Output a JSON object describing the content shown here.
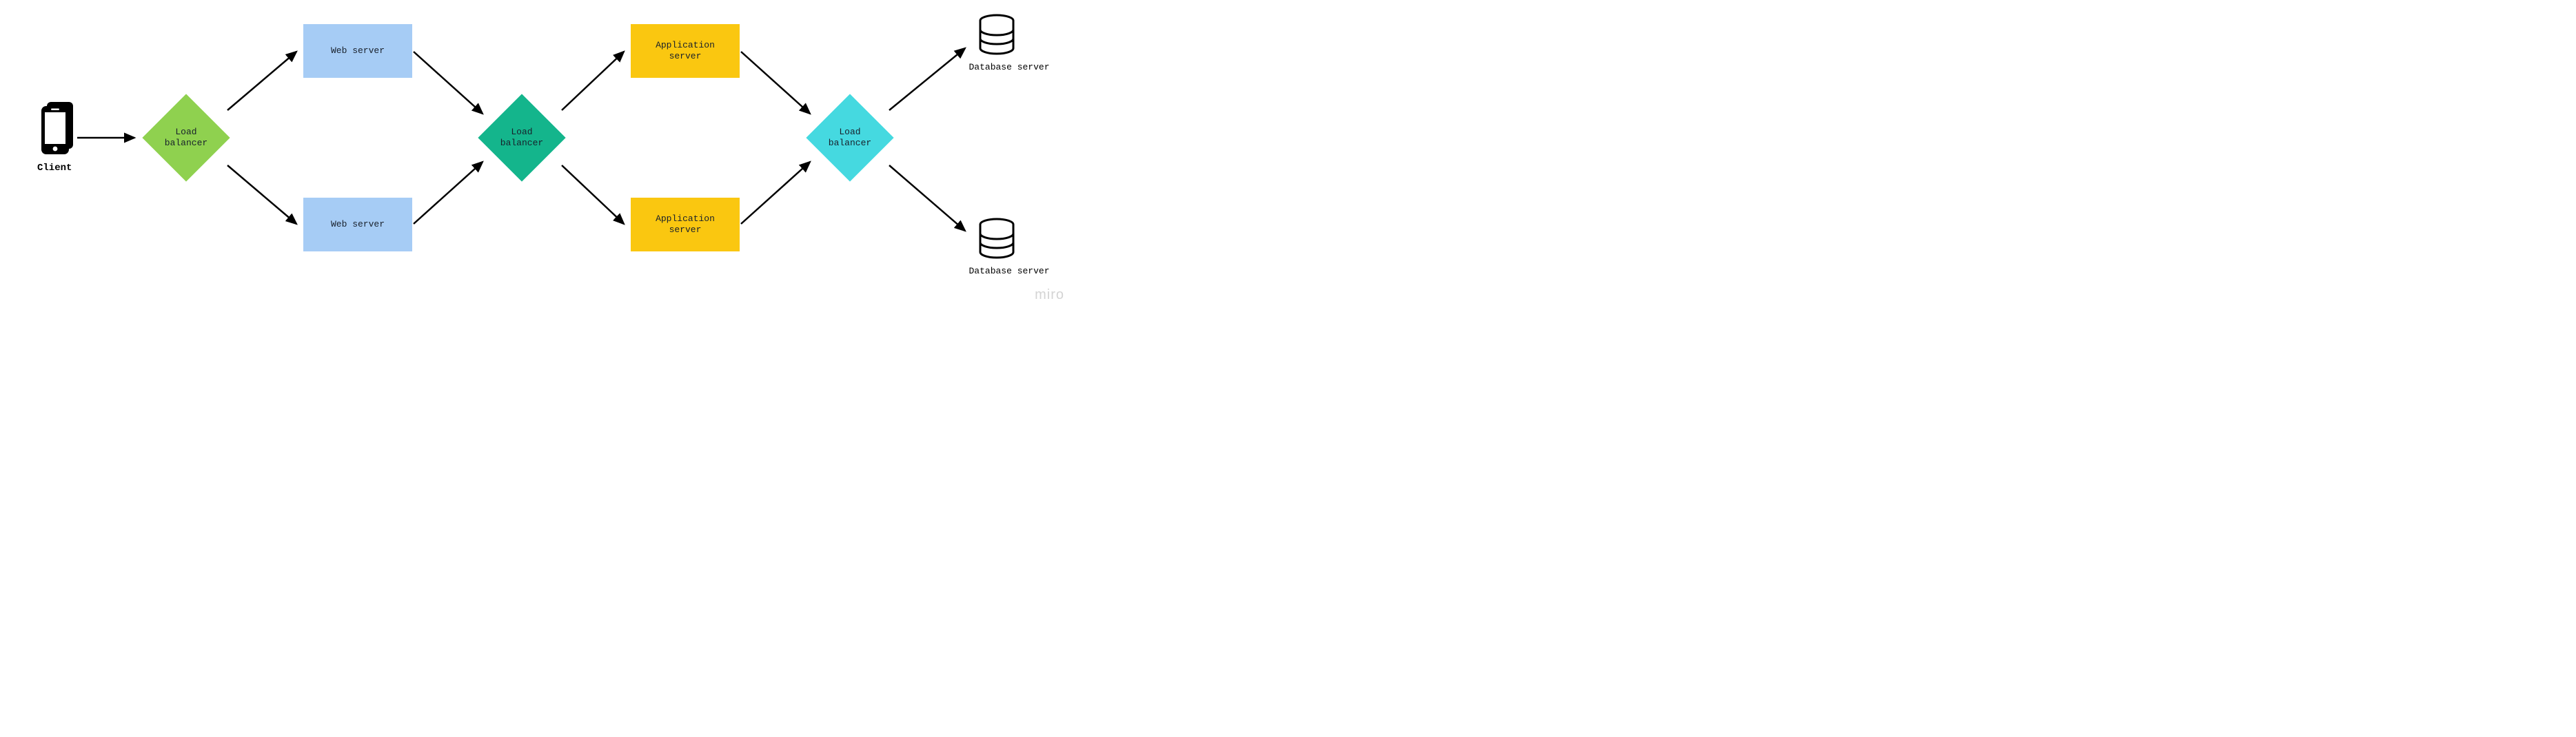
{
  "client": {
    "label": "Client"
  },
  "lb1": {
    "label": "Load\nbalancer",
    "color": "#8fd14f"
  },
  "lb2": {
    "label": "Load\nbalancer",
    "color": "#14b58c"
  },
  "lb3": {
    "label": "Load\nbalancer",
    "color": "#45d9e0"
  },
  "web1": {
    "label": "Web server",
    "color": "#a6ccf5"
  },
  "web2": {
    "label": "Web server",
    "color": "#a6ccf5"
  },
  "app1": {
    "label": "Application\nserver",
    "color": "#fac710"
  },
  "app2": {
    "label": "Application\nserver",
    "color": "#fac710"
  },
  "db1": {
    "label": "Database server"
  },
  "db2": {
    "label": "Database server"
  },
  "watermark": "miro"
}
